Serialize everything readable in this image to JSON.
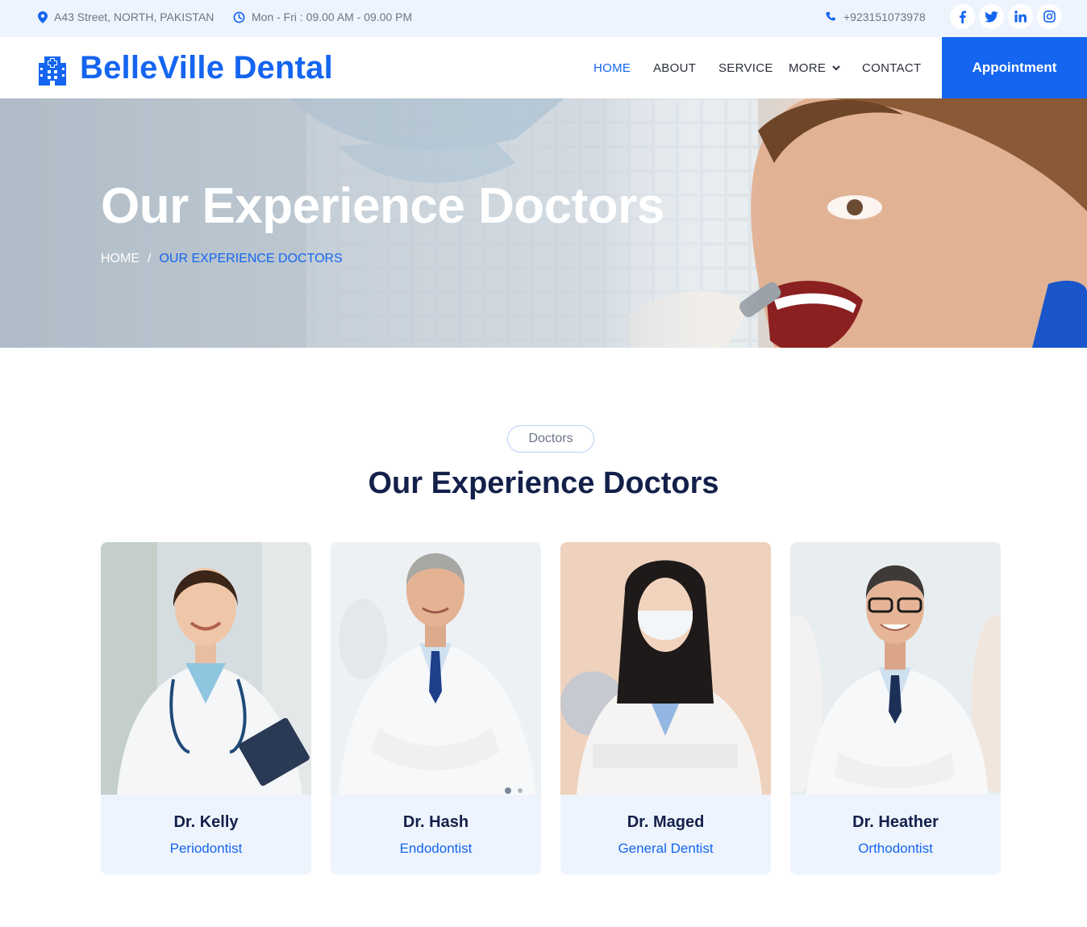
{
  "topbar": {
    "address": "A43 Street, NORTH, PAKISTAN",
    "hours": "Mon - Fri : 09.00 AM - 09.00 PM",
    "phone": "+923151073978",
    "social": [
      "facebook-icon",
      "twitter-icon",
      "linkedin-icon",
      "instagram-icon"
    ]
  },
  "navbar": {
    "brand": "BelleVille Dental",
    "links": [
      "HOME",
      "ABOUT",
      "SERVICE",
      "MORE",
      "CONTACT"
    ],
    "active": "HOME",
    "cta": "Appointment"
  },
  "hero": {
    "title": "Our Experience Doctors",
    "breadcrumb": {
      "home": "HOME",
      "separator": "/",
      "current": "OUR EXPERIENCE DOCTORS"
    }
  },
  "section": {
    "tag": "Doctors",
    "title": "Our Experience Doctors"
  },
  "doctors": [
    {
      "name": "Dr. Kelly",
      "role": "Periodontist"
    },
    {
      "name": "Dr. Hash",
      "role": "Endodontist"
    },
    {
      "name": "Dr. Maged",
      "role": "General Dentist"
    },
    {
      "name": "Dr. Heather",
      "role": "Orthodontist"
    }
  ],
  "colors": {
    "primary": "#1565f0",
    "heading": "#13204a",
    "topbar_bg": "#eef4fd"
  }
}
